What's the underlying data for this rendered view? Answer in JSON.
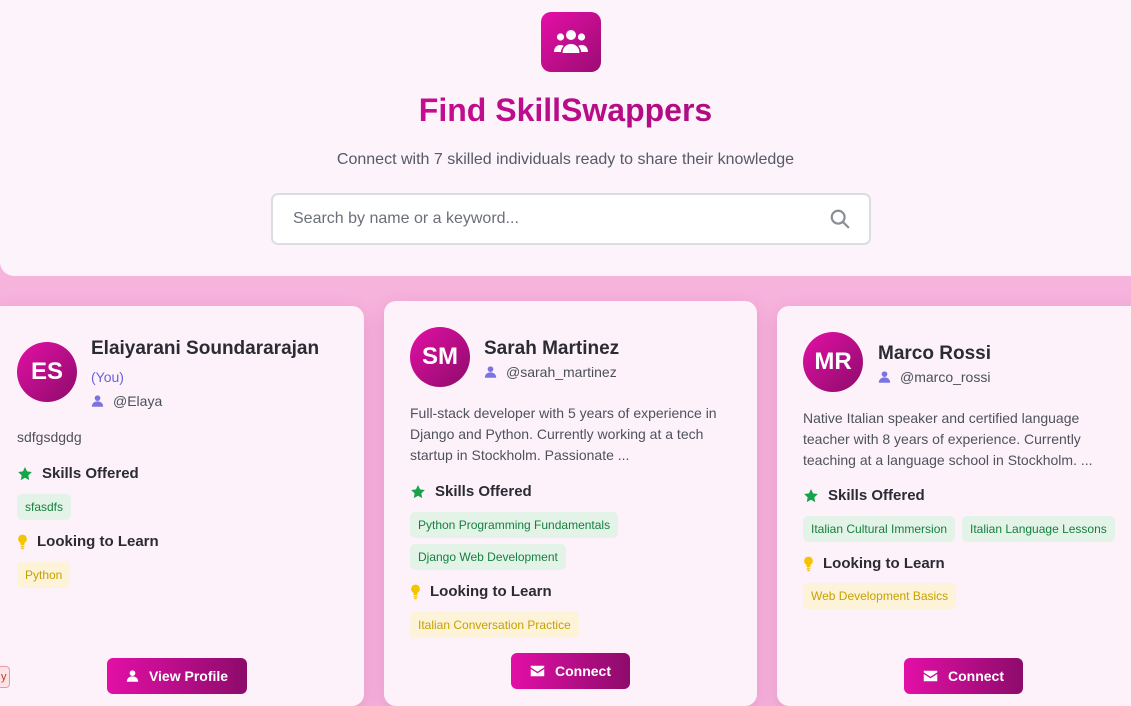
{
  "header": {
    "logo_icon": "users-group-icon",
    "title": "Find SkillSwappers",
    "subtitle": "Connect with 7 skilled individuals ready to share their knowledge",
    "search": {
      "placeholder": "Search by name or a keyword...",
      "value": ""
    }
  },
  "labels": {
    "skills_offered": "Skills Offered",
    "looking_to_learn": "Looking to Learn"
  },
  "cards": [
    {
      "initials": "ES",
      "name": "Elaiyarani Soundararajan",
      "you_label": "(You)",
      "username": "@Elaya",
      "bio": "sdfgsdgdg",
      "skills_offered": [
        "sfasdfs"
      ],
      "looking_to_learn": [
        "Python"
      ],
      "button": "View Profile",
      "button_icon": "user-icon"
    },
    {
      "initials": "SM",
      "name": "Sarah Martinez",
      "username": "@sarah_martinez",
      "bio": "Full-stack developer with 5 years of experience in Django and Python. Currently working at a tech startup in Stockholm. Passionate ...",
      "skills_offered": [
        "Python Programming Fundamentals",
        "Django Web Development"
      ],
      "looking_to_learn": [
        "Italian Conversation Practice"
      ],
      "button": "Connect",
      "button_icon": "envelope-icon"
    },
    {
      "initials": "MR",
      "name": "Marco Rossi",
      "username": "@marco_rossi",
      "bio": "Native Italian speaker and certified language teacher with 8 years of experience. Currently teaching at a language school in Stockholm. ...",
      "skills_offered": [
        "Italian Cultural Immersion",
        "Italian Language Lessons"
      ],
      "looking_to_learn": [
        "Web Development Basics"
      ],
      "button": "Connect",
      "button_icon": "envelope-icon"
    }
  ],
  "edge_badge": "y",
  "colors": {
    "accent": "#e30fa6",
    "accent_dark": "#8d0b6b",
    "page_bg": "#f6b3dc",
    "skill_tag_bg": "#e3f3e8",
    "skill_tag_text": "#17803f",
    "learn_tag_bg": "#fdf3d8",
    "learn_tag_text": "#c9a000"
  }
}
